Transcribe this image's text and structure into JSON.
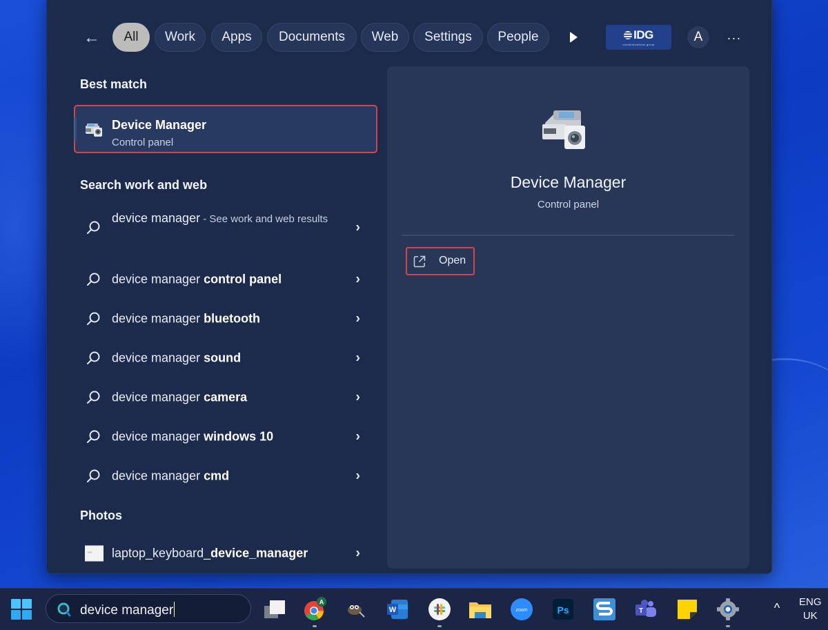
{
  "filters": {
    "back_label": "←",
    "chips": [
      "All",
      "Work",
      "Apps",
      "Documents",
      "Web",
      "Settings",
      "People"
    ],
    "active": "All",
    "org_logo": "IDG",
    "org_tagline": "communications group",
    "avatar_initial": "A",
    "more_label": "···"
  },
  "left": {
    "best_match_heading": "Best match",
    "best_match": {
      "title": "Device Manager",
      "subtitle": "Control panel"
    },
    "search_heading": "Search work and web",
    "search_results": [
      {
        "prefix": "device manager",
        "suffix": "",
        "hint": " - See work and web results"
      },
      {
        "prefix": "device manager ",
        "suffix": "control panel",
        "hint": ""
      },
      {
        "prefix": "device manager ",
        "suffix": "bluetooth",
        "hint": ""
      },
      {
        "prefix": "device manager ",
        "suffix": "sound",
        "hint": ""
      },
      {
        "prefix": "device manager ",
        "suffix": "camera",
        "hint": ""
      },
      {
        "prefix": "device manager ",
        "suffix": "windows 10",
        "hint": ""
      },
      {
        "prefix": "device manager ",
        "suffix": "cmd",
        "hint": ""
      }
    ],
    "photos_heading": "Photos",
    "photo": {
      "prefix": "laptop_keyboard_",
      "bold": "device_manager"
    },
    "chevron": "›"
  },
  "right": {
    "title": "Device Manager",
    "subtitle": "Control panel",
    "open_label": "Open"
  },
  "taskbar": {
    "search_value": "device manager",
    "apps": [
      "Task View",
      "Chrome",
      "GIMP",
      "Word",
      "Slack",
      "File Explorer",
      "Zoom",
      "Photoshop",
      "Snagit",
      "Teams",
      "Sticky Notes",
      "Settings"
    ],
    "chrome_badge": "A",
    "zoom_label": "zoom",
    "ps_label": "Ps",
    "word_label": "W",
    "tray_chevron": "^",
    "lang_line1": "ENG",
    "lang_line2": "UK"
  },
  "colors": {
    "highlight_outline": "#d4454a",
    "panel_bg": "#1c2a4c",
    "pane_bg": "#283757",
    "wallpaper": "#1447cf"
  }
}
